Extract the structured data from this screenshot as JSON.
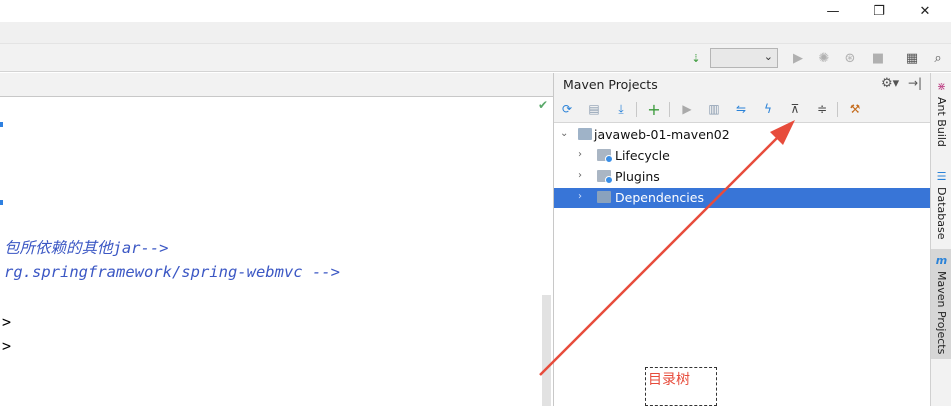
{
  "window": {
    "minimize_icon": "minimize-icon",
    "maximize_icon": "maximize-icon",
    "close_icon": "close-icon",
    "minimize_glyph": "—",
    "maximize_glyph": "❐",
    "close_glyph": "✕"
  },
  "editor": {
    "lines": [
      "包所依赖的其他jar-->",
      "rg.springframework/spring-webmvc -->"
    ],
    "gt_symbols": [
      ">",
      ">"
    ]
  },
  "maven_panel": {
    "title": "Maven Projects",
    "tree": {
      "root": "javaweb-01-maven02",
      "children": [
        {
          "label": "Lifecycle",
          "selected": false
        },
        {
          "label": "Plugins",
          "selected": false
        },
        {
          "label": "Dependencies",
          "selected": true
        }
      ]
    }
  },
  "annotation": {
    "text": "目录树",
    "color": "#e74c3c"
  },
  "right_strip": {
    "tabs": [
      {
        "label": "Ant Build",
        "icon": "ant-icon",
        "active": false
      },
      {
        "label": "Database",
        "icon": "database-icon",
        "active": false
      },
      {
        "label": "Maven Projects",
        "icon": "maven-icon",
        "active": true
      }
    ]
  },
  "colors": {
    "selection": "#3875d7",
    "code_comment": "#3b57c4",
    "arrow": "#e74c3c"
  }
}
